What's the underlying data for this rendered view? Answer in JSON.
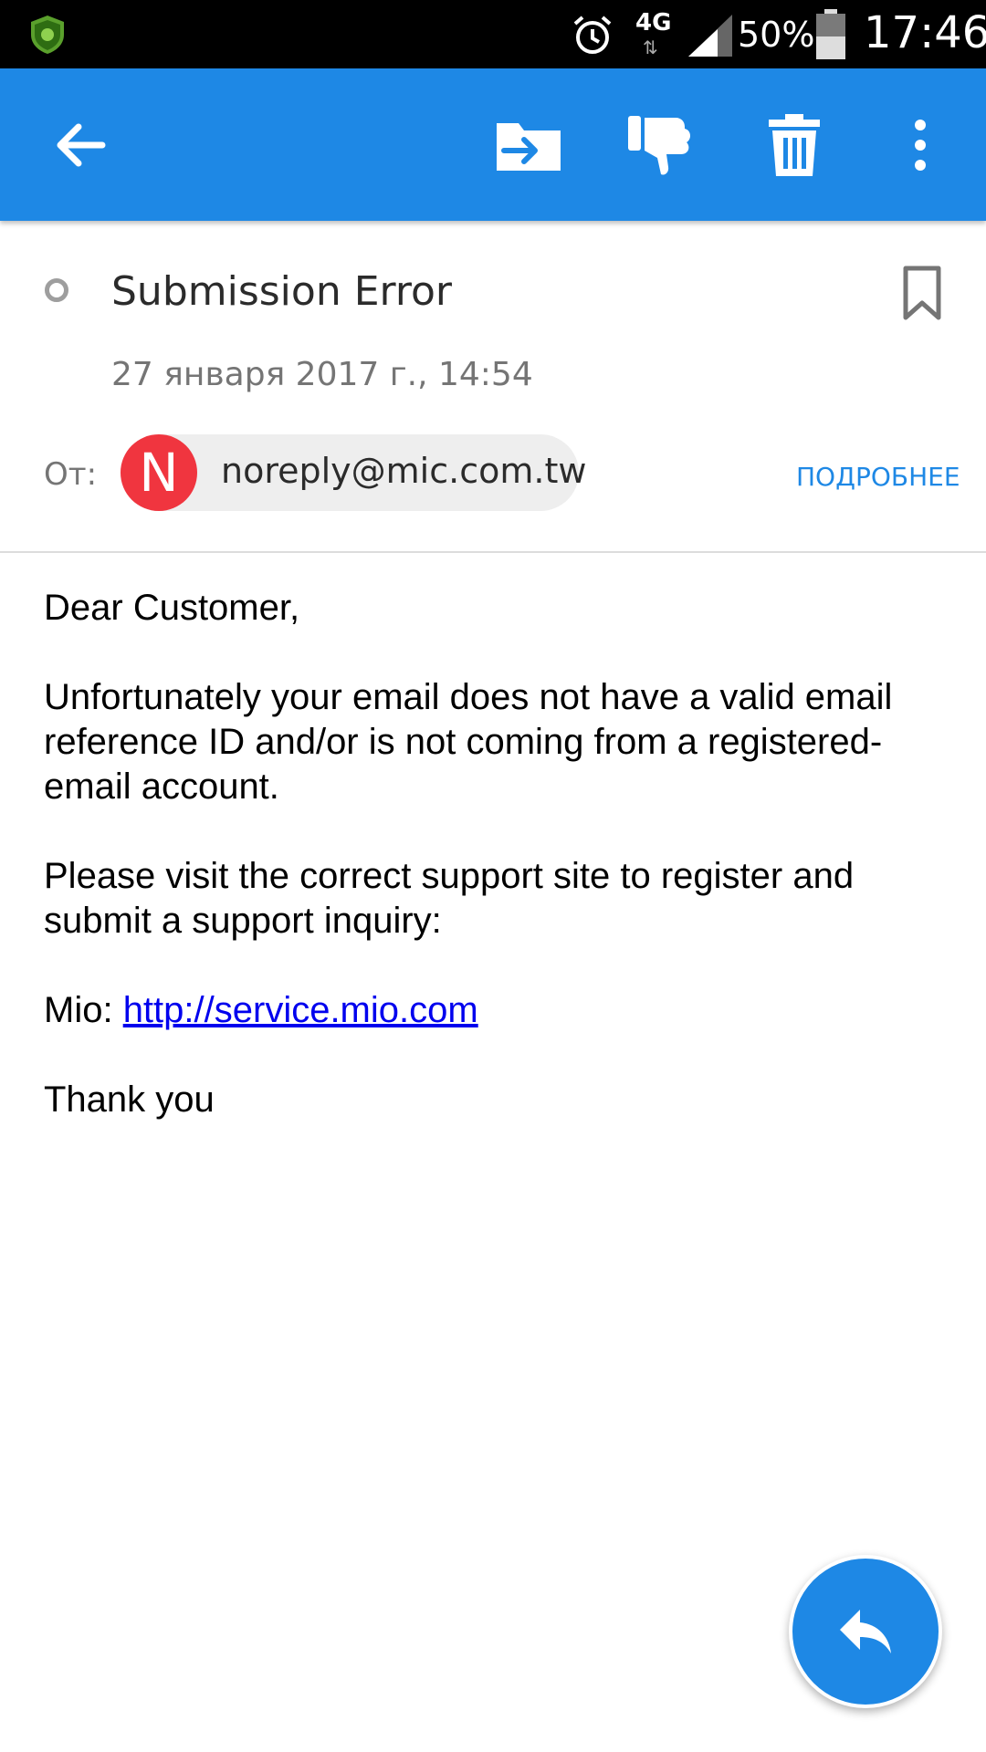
{
  "status_bar": {
    "network": "4G",
    "battery_percent": "50%",
    "time": "17:46",
    "icons": [
      "shield-icon",
      "alarm-icon",
      "signal-icon",
      "battery-icon"
    ]
  },
  "toolbar": {
    "icons": [
      "back-arrow-icon",
      "move-to-folder-icon",
      "thumbs-down-icon",
      "trash-icon",
      "more-vert-icon"
    ]
  },
  "message": {
    "subject": "Submission Error",
    "date": "27 января 2017 г., 14:54",
    "from_label": "От:",
    "sender": {
      "initial": "N",
      "email": "noreply@mic.com.tw",
      "avatar_color": "#f0353f"
    },
    "details_label": "ПОДРОБНЕЕ",
    "body": {
      "greeting": "Dear Customer,",
      "paragraph1": "Unfortunately your email does not have a valid email reference ID and/or is not coming from a registered-email account.",
      "paragraph2": "Please visit the correct support site to register and submit a support inquiry:",
      "link_prefix": "Mio: ",
      "link_text": "http://service.mio.com",
      "closing": "Thank you"
    }
  },
  "fab": {
    "icon": "reply-icon"
  },
  "colors": {
    "accent": "#1e88e5",
    "status_bar": "#000000",
    "link": "#0000ee"
  }
}
